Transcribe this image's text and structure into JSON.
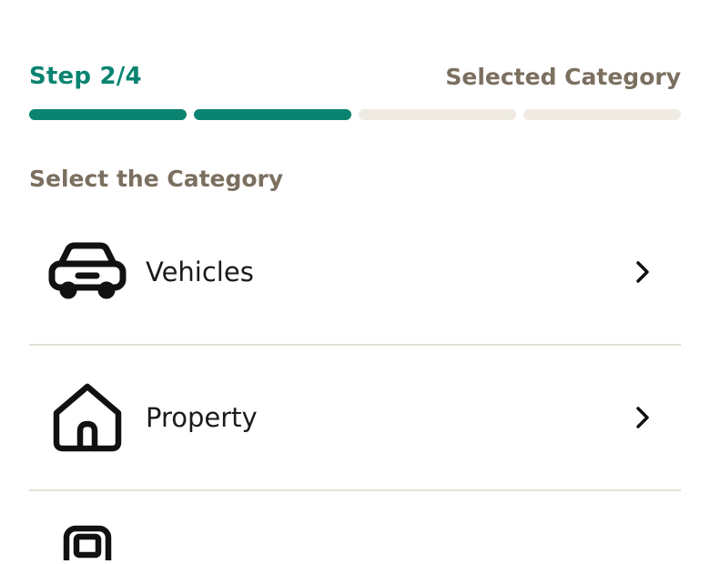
{
  "header": {
    "step": "Step 2/4",
    "title": "Selected Category"
  },
  "progress": {
    "current": 2,
    "total": 4
  },
  "section": {
    "title": "Select the Category"
  },
  "categories": [
    {
      "label": "Vehicles",
      "icon": "car-icon"
    },
    {
      "label": "Property",
      "icon": "house-icon"
    },
    {
      "label": "",
      "icon": "mobile-icon"
    }
  ],
  "colors": {
    "accent": "#0a8471",
    "muted": "#7b6f60",
    "track": "#efebe2",
    "divider": "#e4e0d6"
  }
}
